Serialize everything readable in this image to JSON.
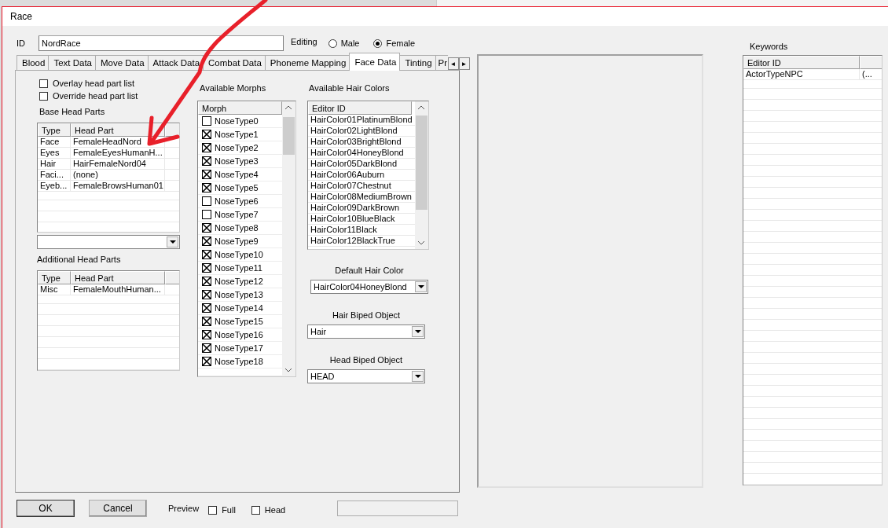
{
  "window": {
    "title": "Race"
  },
  "id_field": {
    "label": "ID",
    "value": "NordRace"
  },
  "editing": {
    "label": "Editing",
    "options": [
      {
        "label": "Male",
        "selected": false
      },
      {
        "label": "Female",
        "selected": true
      }
    ]
  },
  "tabs": [
    {
      "label": "Blood",
      "selected": false
    },
    {
      "label": "Text Data",
      "selected": false
    },
    {
      "label": "Move Data",
      "selected": false
    },
    {
      "label": "Attack Data",
      "selected": false
    },
    {
      "label": "Combat Data",
      "selected": false
    },
    {
      "label": "Phoneme Mapping",
      "selected": false
    },
    {
      "label": "Face Data",
      "selected": true
    },
    {
      "label": "Tinting",
      "selected": false
    },
    {
      "label": "Pr",
      "selected": false
    }
  ],
  "tab_scroll": [
    "◄",
    "►"
  ],
  "options": [
    {
      "label": "Overlay head part list",
      "checked": false
    },
    {
      "label": "Override head part list",
      "checked": false
    }
  ],
  "base_head_parts": {
    "label": "Base Head Parts",
    "columns": [
      "Type",
      "Head Part"
    ],
    "rows": [
      [
        "Face",
        "FemaleHeadNord"
      ],
      [
        "Eyes",
        "FemaleEyesHumanH..."
      ],
      [
        "Hair",
        "HairFemaleNord04"
      ],
      [
        "Faci...",
        "(none)"
      ],
      [
        "Eyeb...",
        "FemaleBrowsHuman01"
      ]
    ]
  },
  "additional_head_parts": {
    "label": "Additional Head Parts",
    "columns": [
      "Type",
      "Head Part"
    ],
    "rows": [
      [
        "Misc",
        "FemaleMouthHuman..."
      ]
    ]
  },
  "available_morphs": {
    "label": "Available Morphs",
    "column": "Morph",
    "items": [
      {
        "label": "NoseType0",
        "checked": false
      },
      {
        "label": "NoseType1",
        "checked": true
      },
      {
        "label": "NoseType2",
        "checked": true
      },
      {
        "label": "NoseType3",
        "checked": true
      },
      {
        "label": "NoseType4",
        "checked": true
      },
      {
        "label": "NoseType5",
        "checked": true
      },
      {
        "label": "NoseType6",
        "checked": false
      },
      {
        "label": "NoseType7",
        "checked": false
      },
      {
        "label": "NoseType8",
        "checked": true
      },
      {
        "label": "NoseType9",
        "checked": true
      },
      {
        "label": "NoseType10",
        "checked": true
      },
      {
        "label": "NoseType11",
        "checked": true
      },
      {
        "label": "NoseType12",
        "checked": true
      },
      {
        "label": "NoseType13",
        "checked": true
      },
      {
        "label": "NoseType14",
        "checked": true
      },
      {
        "label": "NoseType15",
        "checked": true
      },
      {
        "label": "NoseType16",
        "checked": true
      },
      {
        "label": "NoseType17",
        "checked": true
      },
      {
        "label": "NoseType18",
        "checked": true
      }
    ]
  },
  "available_hair_colors": {
    "label": "Available Hair Colors",
    "column": "Editor ID",
    "items": [
      "HairColor01PlatinumBlond",
      "HairColor02LightBlond",
      "HairColor03BrightBlond",
      "HairColor04HoneyBlond",
      "HairColor05DarkBlond",
      "HairColor06Auburn",
      "HairColor07Chestnut",
      "HairColor08MediumBrown",
      "HairColor09DarkBrown",
      "HairColor10BlueBlack",
      "HairColor11Black",
      "HairColor12BlackTrue"
    ]
  },
  "dropdowns": [
    {
      "label": "Default Hair Color",
      "value": "HairColor04HoneyBlond"
    },
    {
      "label": "Hair Biped Object",
      "value": "Hair"
    },
    {
      "label": "Head Biped Object",
      "value": "HEAD"
    }
  ],
  "keywords": {
    "label": "Keywords",
    "columns": [
      "Editor ID"
    ],
    "rows": [
      [
        "ActorTypeNPC",
        "(..."
      ]
    ]
  },
  "buttons": [
    "OK",
    "Cancel"
  ],
  "preview": {
    "label": "Preview",
    "options": [
      {
        "label": "Full",
        "checked": false
      },
      {
        "label": "Head",
        "checked": false
      }
    ]
  }
}
